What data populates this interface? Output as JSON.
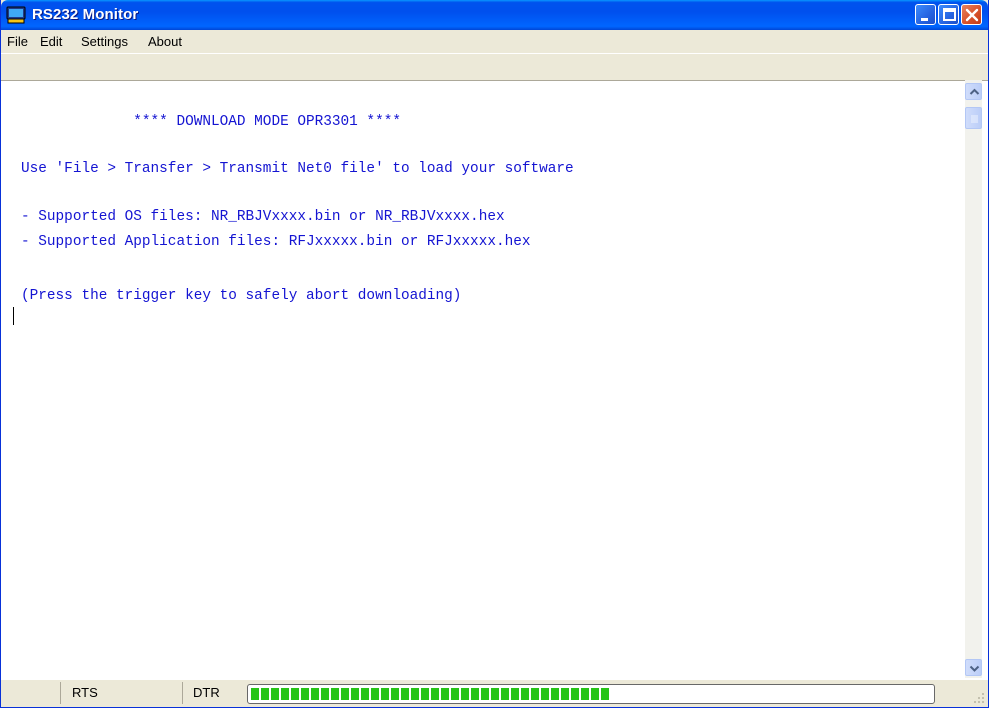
{
  "window": {
    "title": "RS232 Monitor",
    "icon": "serial-monitor-icon",
    "controls": {
      "minimize_icon": "minimize-icon",
      "maximize_icon": "maximize-icon",
      "close_icon": "close-icon"
    }
  },
  "menu": {
    "file": "File",
    "edit": "Edit",
    "settings": "Settings",
    "about": "About"
  },
  "console": {
    "lines": [
      "             **** DOWNLOAD MODE OPR3301 ****",
      "Use 'File > Transfer > Transmit Net0 file' to load your software",
      "- Supported OS files: NR_RBJVxxxx.bin or NR_RBJVxxxx.hex",
      "- Supported Application files: RFJxxxxx.bin or RFJxxxxx.hex",
      "(Press the trigger key to safely abort downloading)"
    ],
    "text_color": "#1414D2"
  },
  "statusbar": {
    "rts": "RTS",
    "dtr": "DTR",
    "progress_fraction": 0.53,
    "progress_color": "#26C416"
  }
}
